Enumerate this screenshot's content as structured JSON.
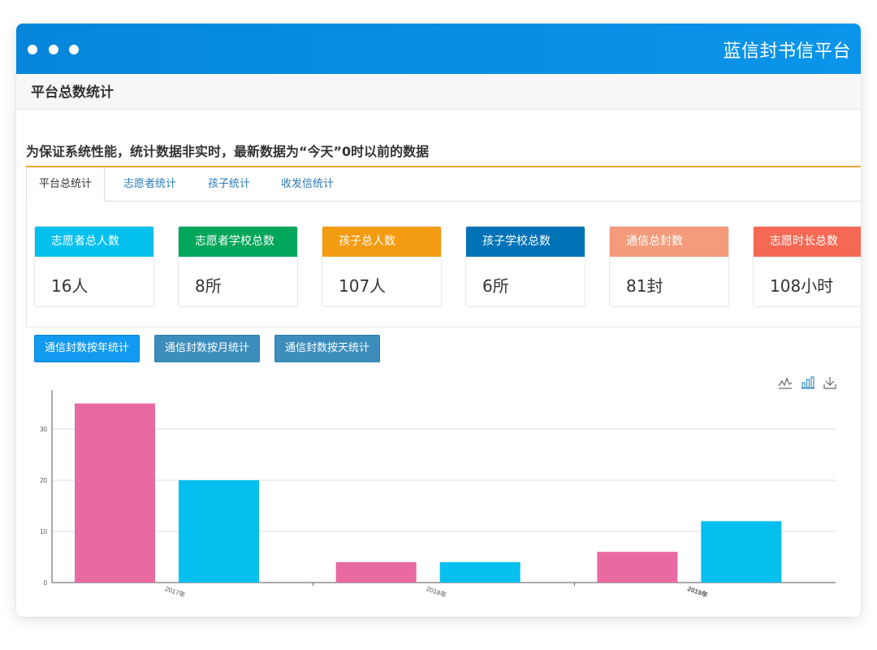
{
  "app": {
    "title": "蓝信封书信平台"
  },
  "section": {
    "title": "平台总数统计"
  },
  "notice": "为保证系统性能，统计数据非实时，最新数据为“今天”0时以前的数据",
  "tabs": [
    {
      "label": "平台总统计",
      "active": true
    },
    {
      "label": "志愿者统计",
      "active": false
    },
    {
      "label": "孩子统计",
      "active": false
    },
    {
      "label": "收发信统计",
      "active": false
    }
  ],
  "stats": [
    {
      "label": "志愿者总人数",
      "value": "16人",
      "color": "#04c0ee"
    },
    {
      "label": "志愿者学校总数",
      "value": "8所",
      "color": "#00a65a"
    },
    {
      "label": "孩子总人数",
      "value": "107人",
      "color": "#f39c12"
    },
    {
      "label": "孩子学校总数",
      "value": "6所",
      "color": "#0073b7"
    },
    {
      "label": "通信总封数",
      "value": "81封",
      "color": "#f39b7b"
    },
    {
      "label": "志愿时长总数",
      "value": "108小时",
      "color": "#f56954"
    }
  ],
  "buttons": [
    {
      "label": "通信封数按年统计"
    },
    {
      "label": "通信封数按月统计"
    },
    {
      "label": "通信封数按天统计"
    }
  ],
  "toolbox": [
    "line-chart-icon",
    "bar-chart-icon",
    "download-icon"
  ],
  "chart_data": {
    "type": "bar",
    "categories": [
      "2017年",
      "2018年",
      "2019年"
    ],
    "series": [
      {
        "values": [
          35,
          4,
          6
        ],
        "color": "#e96aa0"
      },
      {
        "values": [
          20,
          4,
          12
        ],
        "color": "#05c0ee"
      }
    ],
    "ylim": [
      0,
      37
    ],
    "yticks": [
      0,
      10,
      20,
      30
    ],
    "grid": true
  }
}
